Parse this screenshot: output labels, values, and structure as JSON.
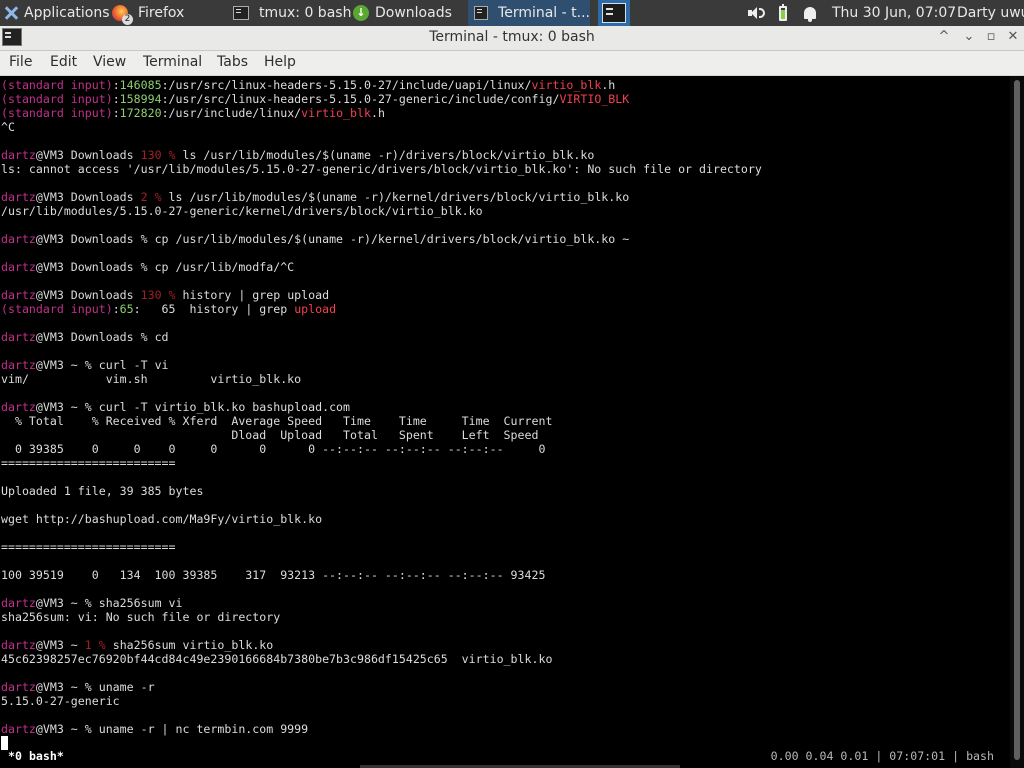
{
  "panel": {
    "applications": "Applications",
    "firefox": "Firefox",
    "firefox_badge": "2",
    "tmux_task": "tmux: 0 bash",
    "downloads": "Downloads",
    "terminal_task": "Terminal - t...",
    "clock": "Thu 30 Jun, 07:07",
    "user": "Darty uwu"
  },
  "window": {
    "title": "Terminal - tmux: 0 bash",
    "minimize": "^",
    "restore": "▫",
    "close": "✕"
  },
  "menu": [
    "File",
    "Edit",
    "View",
    "Terminal",
    "Tabs",
    "Help"
  ],
  "lines": [
    [
      {
        "t": "(standard input)",
        "c": "pink"
      },
      {
        "t": ":"
      },
      {
        "t": "146085",
        "c": "green"
      },
      {
        "t": ":/usr/src/linux-headers-5.15.0-27/include/uapi/linux/"
      },
      {
        "t": "virtio_blk",
        "c": "red"
      },
      {
        "t": ".h"
      }
    ],
    [
      {
        "t": "(standard input)",
        "c": "pink"
      },
      {
        "t": ":"
      },
      {
        "t": "158994",
        "c": "green"
      },
      {
        "t": ":/usr/src/linux-headers-5.15.0-27-generic/include/config/"
      },
      {
        "t": "VIRTIO_BLK",
        "c": "red"
      }
    ],
    [
      {
        "t": "(standard input)",
        "c": "pink"
      },
      {
        "t": ":"
      },
      {
        "t": "172820",
        "c": "green"
      },
      {
        "t": ":/usr/include/linux/"
      },
      {
        "t": "virtio_blk",
        "c": "red"
      },
      {
        "t": ".h"
      }
    ],
    [
      {
        "t": "^C"
      }
    ],
    [],
    [
      {
        "t": "dartz",
        "c": "pink"
      },
      {
        "t": "@VM3 Downloads "
      },
      {
        "t": "130 %",
        "c": "dred"
      },
      {
        "t": " ls /usr/lib/modules/$(uname -r)/drivers/block/virtio_blk.ko"
      }
    ],
    [
      {
        "t": "ls: cannot access '/usr/lib/modules/5.15.0-27-generic/drivers/block/virtio_blk.ko': No such file or directory"
      }
    ],
    [],
    [
      {
        "t": "dartz",
        "c": "pink"
      },
      {
        "t": "@VM3 Downloads "
      },
      {
        "t": "2 %",
        "c": "dred"
      },
      {
        "t": " ls /usr/lib/modules/$(uname -r)/kernel/drivers/block/virtio_blk.ko"
      }
    ],
    [
      {
        "t": "/usr/lib/modules/5.15.0-27-generic/kernel/drivers/block/virtio_blk.ko"
      }
    ],
    [],
    [
      {
        "t": "dartz",
        "c": "pink"
      },
      {
        "t": "@VM3 Downloads % cp /usr/lib/modules/$(uname -r)/kernel/drivers/block/virtio_blk.ko ~"
      }
    ],
    [],
    [
      {
        "t": "dartz",
        "c": "pink"
      },
      {
        "t": "@VM3 Downloads % cp /usr/lib/modfa/^C"
      }
    ],
    [],
    [
      {
        "t": "dartz",
        "c": "pink"
      },
      {
        "t": "@VM3 Downloads "
      },
      {
        "t": "130 %",
        "c": "dred"
      },
      {
        "t": " history | grep upload"
      }
    ],
    [
      {
        "t": "(standard input)",
        "c": "pink"
      },
      {
        "t": ":"
      },
      {
        "t": "65",
        "c": "green"
      },
      {
        "t": ":   65  history | grep "
      },
      {
        "t": "upload",
        "c": "red"
      }
    ],
    [],
    [
      {
        "t": "dartz",
        "c": "pink"
      },
      {
        "t": "@VM3 Downloads % cd"
      }
    ],
    [],
    [
      {
        "t": "dartz",
        "c": "pink"
      },
      {
        "t": "@VM3 ~ % curl -T vi"
      }
    ],
    [
      {
        "t": "vim/           vim.sh         virtio_blk.ko"
      }
    ],
    [],
    [
      {
        "t": "dartz",
        "c": "pink"
      },
      {
        "t": "@VM3 ~ % curl -T virtio_blk.ko bashupload.com"
      }
    ],
    [
      {
        "t": "  % Total    % Received % Xferd  Average Speed   Time    Time     Time  Current"
      }
    ],
    [
      {
        "t": "                                 Dload  Upload   Total   Spent    Left  Speed"
      }
    ],
    [
      {
        "t": "  0 39385    0     0    0     0      0      0 --:--:-- --:--:-- --:--:--     0"
      }
    ],
    [
      {
        "t": "========================="
      }
    ],
    [],
    [
      {
        "t": "Uploaded 1 file, 39 385 bytes"
      }
    ],
    [],
    [
      {
        "t": "wget http://bashupload.com/Ma9Fy/virtio_blk.ko"
      }
    ],
    [],
    [
      {
        "t": "========================="
      }
    ],
    [],
    [
      {
        "t": "100 39519    0   134  100 39385    317  93213 --:--:-- --:--:-- --:--:-- 93425"
      }
    ],
    [],
    [
      {
        "t": "dartz",
        "c": "pink"
      },
      {
        "t": "@VM3 ~ % sha256sum vi"
      }
    ],
    [
      {
        "t": "sha256sum: vi: No such file or directory"
      }
    ],
    [],
    [
      {
        "t": "dartz",
        "c": "pink"
      },
      {
        "t": "@VM3 ~ "
      },
      {
        "t": "1 %",
        "c": "dred"
      },
      {
        "t": " sha256sum virtio_blk.ko"
      }
    ],
    [
      {
        "t": "45c62398257ec76920bf44cd84c49e2390166684b7380be7b3c986df15425c65  virtio_blk.ko"
      }
    ],
    [],
    [
      {
        "t": "dartz",
        "c": "pink"
      },
      {
        "t": "@VM3 ~ % uname -r"
      }
    ],
    [
      {
        "t": "5.15.0-27-generic"
      }
    ],
    [],
    [
      {
        "t": "dartz",
        "c": "pink"
      },
      {
        "t": "@VM3 ~ % uname -r | nc termbin.com 9999"
      }
    ]
  ],
  "status": {
    "left": "*0 bash*",
    "right": "0.00 0.04 0.01 | 07:07:01 | bash"
  }
}
